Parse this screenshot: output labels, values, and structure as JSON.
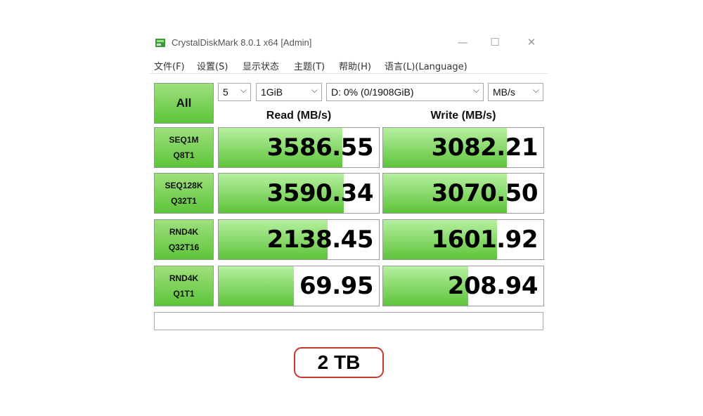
{
  "window": {
    "title": "CrystalDiskMark 8.0.1 x64 [Admin]",
    "controls": {
      "minimize": "—",
      "maximize": "☐",
      "close": "✕"
    }
  },
  "menu": [
    "文件(F)",
    "设置(S)",
    "显示状态",
    "主题(T)",
    "帮助(H)",
    "语言(L)(Language)"
  ],
  "toolbar": {
    "all_label": "All",
    "count": "5",
    "size": "1GiB",
    "drive": "D: 0% (0/1908GiB)",
    "unit": "MB/s"
  },
  "headers": {
    "read": "Read (MB/s)",
    "write": "Write (MB/s)"
  },
  "rows": [
    {
      "label1": "SEQ1M",
      "label2": "Q8T1",
      "read": "3586.55",
      "write": "3082.21",
      "read_fill": 0.77,
      "write_fill": 0.77
    },
    {
      "label1": "SEQ128K",
      "label2": "Q32T1",
      "read": "3590.34",
      "write": "3070.50",
      "read_fill": 0.78,
      "write_fill": 0.77
    },
    {
      "label1": "RND4K",
      "label2": "Q32T16",
      "read": "2138.45",
      "write": "1601.92",
      "read_fill": 0.68,
      "write_fill": 0.71
    },
    {
      "label1": "RND4K",
      "label2": "Q1T1",
      "read": "69.95",
      "write": "208.94",
      "read_fill": 0.47,
      "write_fill": 0.53
    }
  ],
  "comment": "",
  "capacity": "2 TB",
  "colors": {
    "accent_green": "#5ec43a",
    "badge_border": "#c0392b"
  }
}
